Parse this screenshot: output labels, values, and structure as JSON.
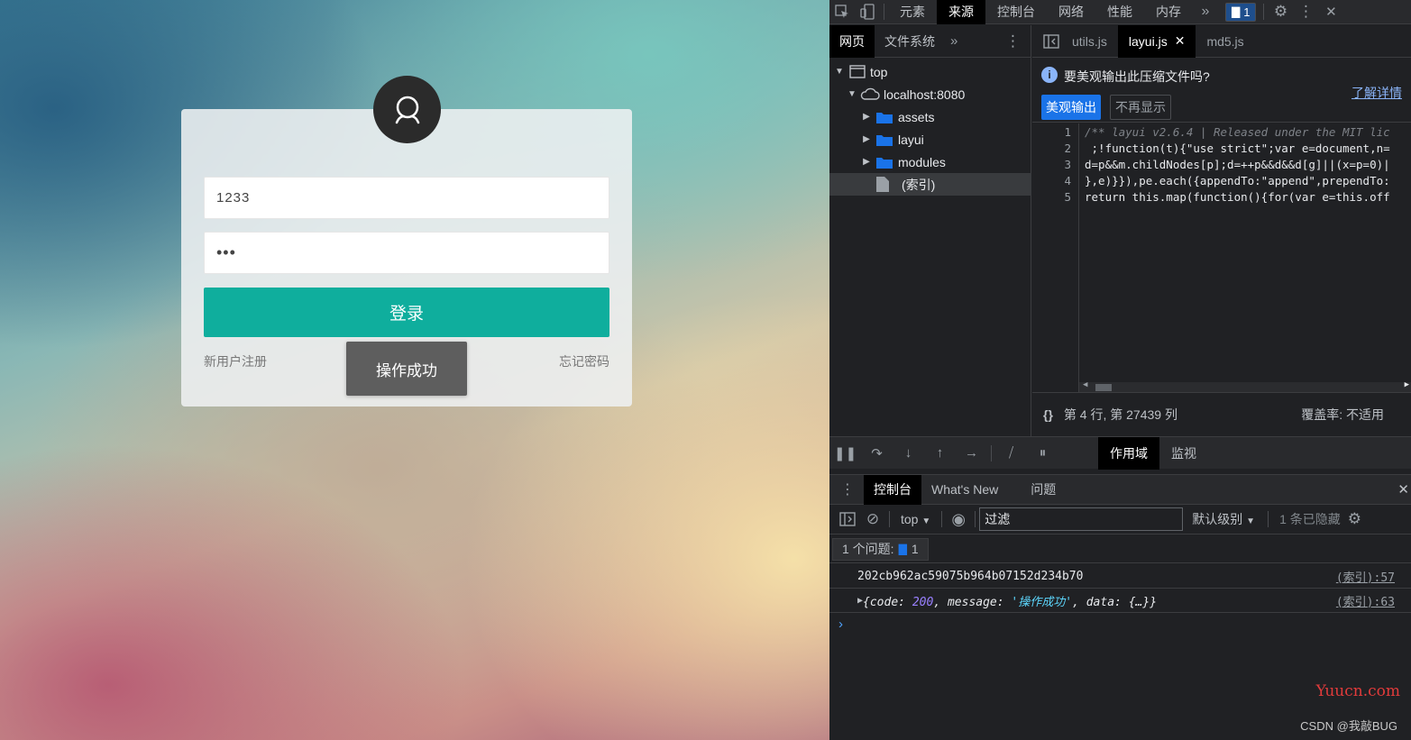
{
  "login": {
    "username_value": "1233",
    "password_value": "•••",
    "login_label": "登录",
    "register_label": "新用户注册",
    "forgot_label": "忘记密码",
    "toast_text": "操作成功"
  },
  "devtools": {
    "main_tabs": [
      "元素",
      "来源",
      "控制台",
      "网络",
      "性能",
      "内存"
    ],
    "active_main_tab": "来源",
    "issue_count": "1",
    "navigator": {
      "tabs": [
        "网页",
        "文件系统"
      ],
      "tree": [
        "top",
        "localhost:8080",
        "assets",
        "layui",
        "modules",
        "(索引)"
      ]
    },
    "editor": {
      "file_tabs": [
        "utils.js",
        "layui.js",
        "md5.js"
      ],
      "active_file": "layui.js",
      "pretty_question": "要美观输出此压缩文件吗?",
      "learn_more": "了解详情",
      "pretty_button": "美观输出",
      "dismiss_button": "不再显示",
      "line_numbers": [
        "1",
        "2",
        "3",
        "4",
        "5"
      ],
      "code_lines": [
        "/** layui v2.6.4 | Released under the MIT lic",
        " ;!function(t){\"use strict\";var e=document,n=",
        "d=p&&m.childNodes[p];d=++p&&d&&d[g]||(x=p=0)|",
        "},e)}}),pe.each({appendTo:\"append\",prependTo:",
        "return this.map(function(){for(var e=this.off"
      ],
      "cursor_position": "第 4 行, 第 27439 列",
      "coverage": "覆盖率: 不适用"
    },
    "debug_tabs": [
      "作用域",
      "监视"
    ],
    "drawer_tabs": [
      "控制台",
      "What's New",
      "问题"
    ],
    "console": {
      "context": "top",
      "filter_placeholder": "过滤",
      "level": "默认级别",
      "hidden_count": "1 条已隐藏",
      "issues_label": "1 个问题:",
      "issues_count": "1",
      "logs": [
        {
          "text": "202cb962ac59075b964b07152d234b70",
          "source": "(索引):57"
        },
        {
          "key1": "code",
          "val1": "200",
          "key2": "message",
          "val2": "'操作成功'",
          "key3": "data",
          "val3": "{…}",
          "source": "(索引):63"
        }
      ]
    }
  },
  "watermarks": {
    "yuucn": "Yuucn.com",
    "csdn": "CSDN @我敲BUG"
  }
}
